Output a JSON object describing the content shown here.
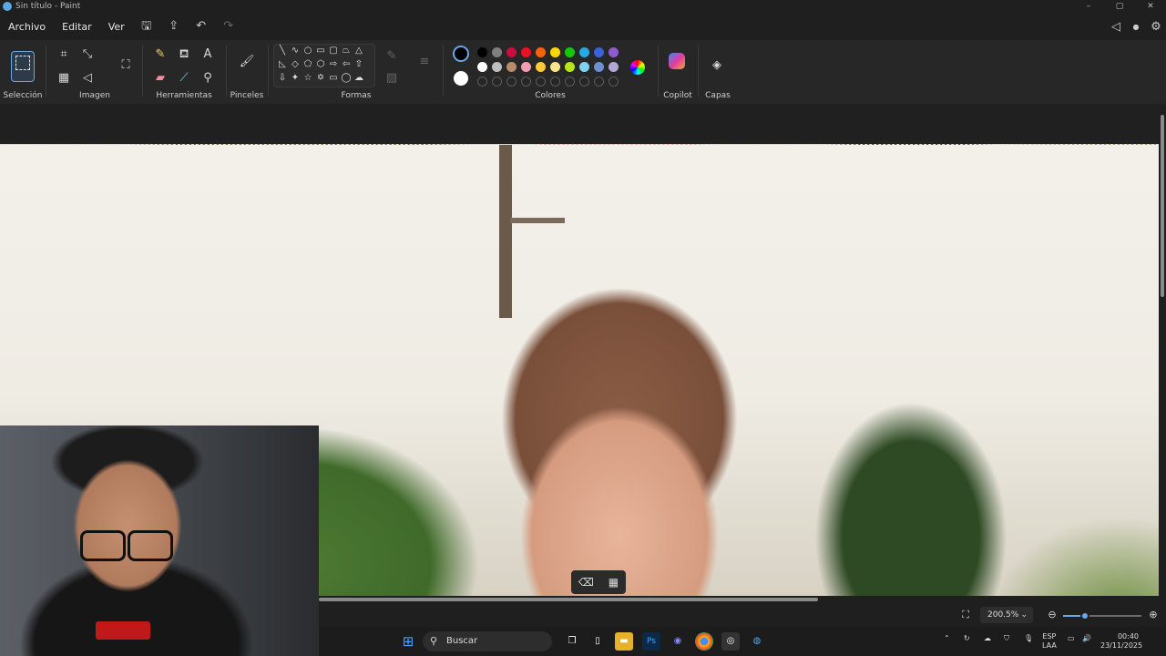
{
  "window": {
    "title": "Sin título - Paint",
    "controls": [
      "–",
      "▢",
      "✕"
    ]
  },
  "menu": {
    "items": [
      "Archivo",
      "Editar",
      "Ver"
    ]
  },
  "ribbon": {
    "groups": {
      "seleccion": "Selección",
      "imagen": "Imagen",
      "herramientas": "Herramientas",
      "pinceles": "Pinceles",
      "formas": "Formas",
      "colores": "Colores",
      "copilot": "Copilot",
      "capas": "Capas"
    }
  },
  "colors": {
    "row1": [
      "#000000",
      "#7f7f7f",
      "#c3103c",
      "#e81123",
      "#f7630c",
      "#ffd700",
      "#16c60c",
      "#2aa7e6",
      "#3a63d8",
      "#8e5bd1"
    ],
    "row2": [
      "#ffffff",
      "#bfbfbf",
      "#b68c6a",
      "#f39db5",
      "#ffc83d",
      "#f6e58d",
      "#b5e61d",
      "#7fd3f0",
      "#6e8fd1",
      "#b4a7d6"
    ],
    "current_primary": "#000000",
    "current_secondary": "#ffffff"
  },
  "status": {
    "zoom_label": "200.5%",
    "zoom_level": 0.28
  },
  "taskbar": {
    "search_label": "Buscar",
    "lang_top": "ESP",
    "lang_bottom": "LAA",
    "time": "00:40",
    "date": "23/11/2025"
  }
}
